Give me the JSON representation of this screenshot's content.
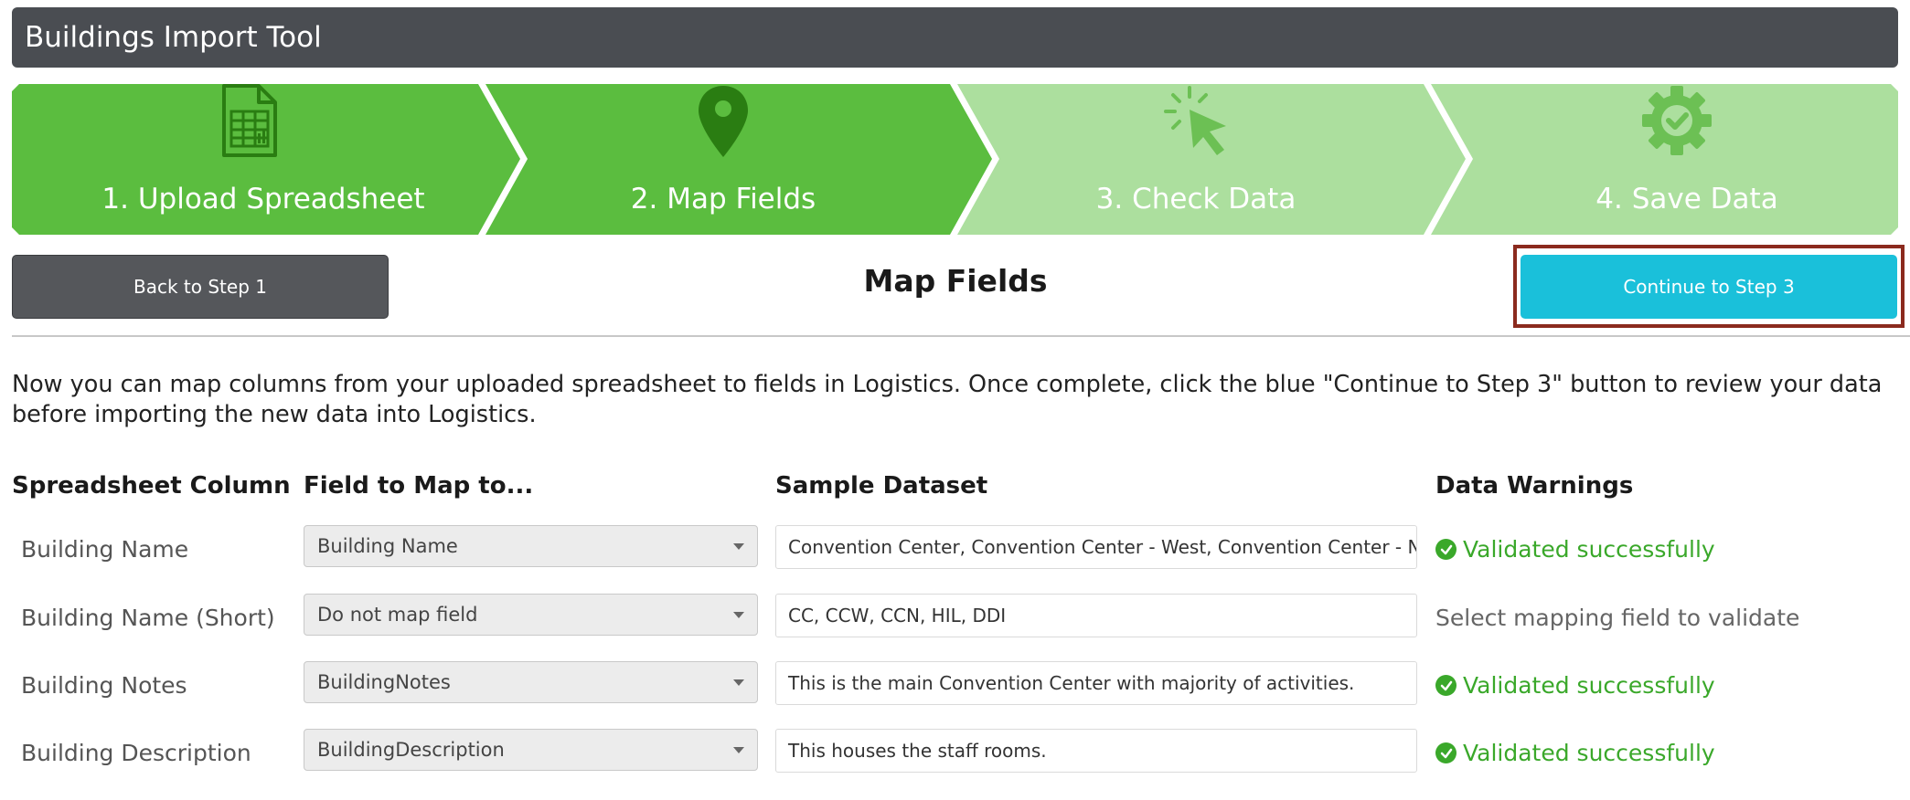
{
  "app": {
    "title": "Buildings Import Tool"
  },
  "wizard": {
    "steps": [
      {
        "label": "1. Upload Spreadsheet",
        "icon": "spreadsheet-icon",
        "state": "complete"
      },
      {
        "label": "2. Map Fields",
        "icon": "map-pin-icon",
        "state": "active"
      },
      {
        "label": "3. Check Data",
        "icon": "cursor-click-icon",
        "state": "upcoming"
      },
      {
        "label": "4. Save Data",
        "icon": "gear-check-icon",
        "state": "upcoming"
      }
    ],
    "colors": {
      "active": "#5bbd3f",
      "upcoming": "#acdf9e",
      "icon_active": "#2a7d12",
      "icon_upcoming": "#6cc054"
    }
  },
  "toolbar": {
    "back_label": "Back to Step 1",
    "title": "Map Fields",
    "continue_label": "Continue to Step 3"
  },
  "intro": "Now you can map columns from your uploaded spreadsheet to fields in Logistics. Once complete, click the blue \"Continue to Step 3\" button to review your data before importing the new data into Logistics.",
  "table": {
    "headers": [
      "Spreadsheet Column",
      "Field to Map to...",
      "Sample Dataset",
      "Data Warnings"
    ],
    "rows": [
      {
        "column": "Building Name",
        "field": "Building Name",
        "sample": "Convention Center, Convention Center - West, Convention Center - North, Hilton, DDI",
        "warning": "Validated successfully",
        "status": "ok"
      },
      {
        "column": "Building Name (Short)",
        "field": "Do not map field",
        "sample": "CC, CCW, CCN, HIL, DDI",
        "warning": "Select mapping field to validate",
        "status": "pending"
      },
      {
        "column": "Building Notes",
        "field": "BuildingNotes",
        "sample": "This is the main Convention Center with majority of activities.",
        "warning": "Validated successfully",
        "status": "ok"
      },
      {
        "column": "Building Description",
        "field": "BuildingDescription",
        "sample": "This houses the staff rooms.",
        "warning": "Validated successfully",
        "status": "ok"
      }
    ]
  }
}
